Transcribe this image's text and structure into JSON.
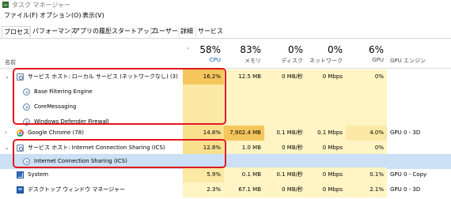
{
  "window": {
    "title": "タスク マネージャー"
  },
  "menu": {
    "file": "ファイル(F)",
    "options": "オプション(O)",
    "view": "表示(V)"
  },
  "tabs": [
    "プロセス",
    "パフォーマンス",
    "アプリの履歴",
    "スタートアップ",
    "ユーザー",
    "詳細",
    "サービス"
  ],
  "header": {
    "name_label": "名前",
    "cpu": {
      "pct": "58%",
      "label": "CPU"
    },
    "memory": {
      "pct": "83%",
      "label": "メモリ"
    },
    "disk": {
      "pct": "0%",
      "label": "ディスク"
    },
    "network": {
      "pct": "0%",
      "label": "ネットワーク"
    },
    "gpu": {
      "pct": "6%",
      "label": "GPU"
    },
    "gpu_engine": {
      "label": "GPU エンジン"
    }
  },
  "rows": [
    {
      "name": "サービス ホスト: ローカル サービス (ネットワークなし) (3)",
      "cpu": "16.2%",
      "mem": "12.5 MB",
      "disk": "0 MB/秒",
      "net": "0 Mbps",
      "gpu": "0%",
      "gpu_engine": ""
    },
    {
      "name": "Base Filtering Engine"
    },
    {
      "name": "CoreMessaging"
    },
    {
      "name": "Windows Defender Firewall"
    },
    {
      "name": "Google Chrome (78)",
      "cpu": "14.8%",
      "mem": "7,902.4 MB",
      "disk": "0.1 MB/秒",
      "net": "0.1 Mbps",
      "gpu": "4.0%",
      "gpu_engine": "GPU 0 - 3D"
    },
    {
      "name": "サービス ホスト: Internet Connection Sharing (ICS)",
      "cpu": "12.8%",
      "mem": "1.0 MB",
      "disk": "0 MB/秒",
      "net": "0 Mbps",
      "gpu": "0%",
      "gpu_engine": ""
    },
    {
      "name": "Internet Connection Sharing (ICS)"
    },
    {
      "name": "System",
      "cpu": "5.9%",
      "mem": "0.1 MB",
      "disk": "0.1 MB/秒",
      "net": "0 Mbps",
      "gpu": "0.1%",
      "gpu_engine": "GPU 0 - Copy"
    },
    {
      "name": "デスクトップ ウィンドウ マネージャー",
      "cpu": "2.3%",
      "mem": "67.1 MB",
      "disk": "0 MB/秒",
      "net": "0 Mbps",
      "gpu": "2.1%",
      "gpu_engine": "GPU 0 - 3D"
    }
  ],
  "colors": {
    "highlight_box": "#e0191f",
    "heat_high": "#f4c65c",
    "heat_mid": "#fbe9a5",
    "heat_low": "#fff4c4",
    "selected_row": "#cce0f5"
  }
}
